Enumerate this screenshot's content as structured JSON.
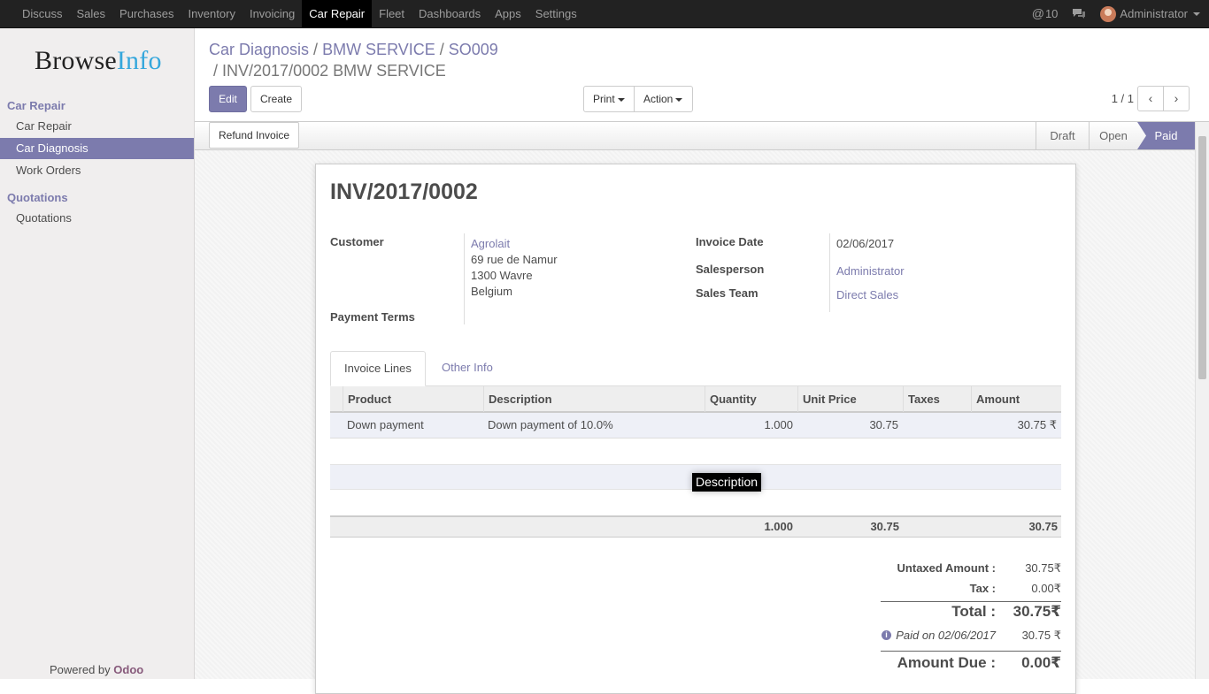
{
  "topbar": {
    "menu": [
      "Discuss",
      "Sales",
      "Purchases",
      "Inventory",
      "Invoicing",
      "Car Repair",
      "Fleet",
      "Dashboards",
      "Apps",
      "Settings"
    ],
    "mentions": "10",
    "user": "Administrator",
    "icons": [
      "at-icon",
      "chat-icon",
      "avatar-icon"
    ]
  },
  "sidebar": {
    "logo_part1": "Browse",
    "logo_part2": "Info",
    "section1": "Car Repair",
    "items1": [
      "Car Repair",
      "Car Diagnosis",
      "Work Orders"
    ],
    "section2": "Quotations",
    "items2": [
      "Quotations"
    ],
    "powered_prefix": "Powered by",
    "powered_brand": "Odoo"
  },
  "breadcrumb": {
    "b1": "Car Diagnosis",
    "b2": "BMW SERVICE",
    "b3": "SO009",
    "current": "INV/2017/0002 BMW SERVICE"
  },
  "buttons": {
    "edit": "Edit",
    "create": "Create",
    "print": "Print",
    "action": "Action",
    "refund": "Refund Invoice"
  },
  "pager": "1 / 1",
  "stages": [
    "Draft",
    "Open",
    "Paid"
  ],
  "invoice": {
    "number": "INV/2017/0002",
    "customer_label": "Customer",
    "customer_name": "Agrolait",
    "addr1": "69 rue de Namur",
    "addr2": "1300 Wavre",
    "addr3": "Belgium",
    "payment_terms_label": "Payment Terms",
    "invoice_date_label": "Invoice Date",
    "invoice_date": "02/06/2017",
    "salesperson_label": "Salesperson",
    "salesperson": "Administrator",
    "sales_team_label": "Sales Team",
    "sales_team": "Direct Sales"
  },
  "tabs": [
    "Invoice Lines",
    "Other Info"
  ],
  "table": {
    "headers": [
      "Product",
      "Description",
      "Quantity",
      "Unit Price",
      "Taxes",
      "Amount"
    ],
    "rows": [
      {
        "product": "Down payment",
        "description": "Down payment of 10.0%",
        "quantity": "1.000",
        "unit_price": "30.75",
        "taxes": "",
        "amount": "30.75 ₹"
      }
    ],
    "footer": {
      "quantity": "1.000",
      "unit_price": "30.75",
      "amount": "30.75"
    }
  },
  "tooltip": "Description",
  "totals": {
    "untaxed_label": "Untaxed Amount :",
    "untaxed": "30.75₹",
    "tax_label": "Tax :",
    "tax": "0.00₹",
    "total_label": "Total :",
    "total": "30.75₹",
    "paid_on": "Paid on 02/06/2017",
    "paid_amount": "30.75 ₹",
    "due_label": "Amount Due :",
    "due": "0.00₹"
  },
  "colors": {
    "accent": "#7c7bad",
    "topbar": "#222222",
    "brand": "#875a7b"
  }
}
